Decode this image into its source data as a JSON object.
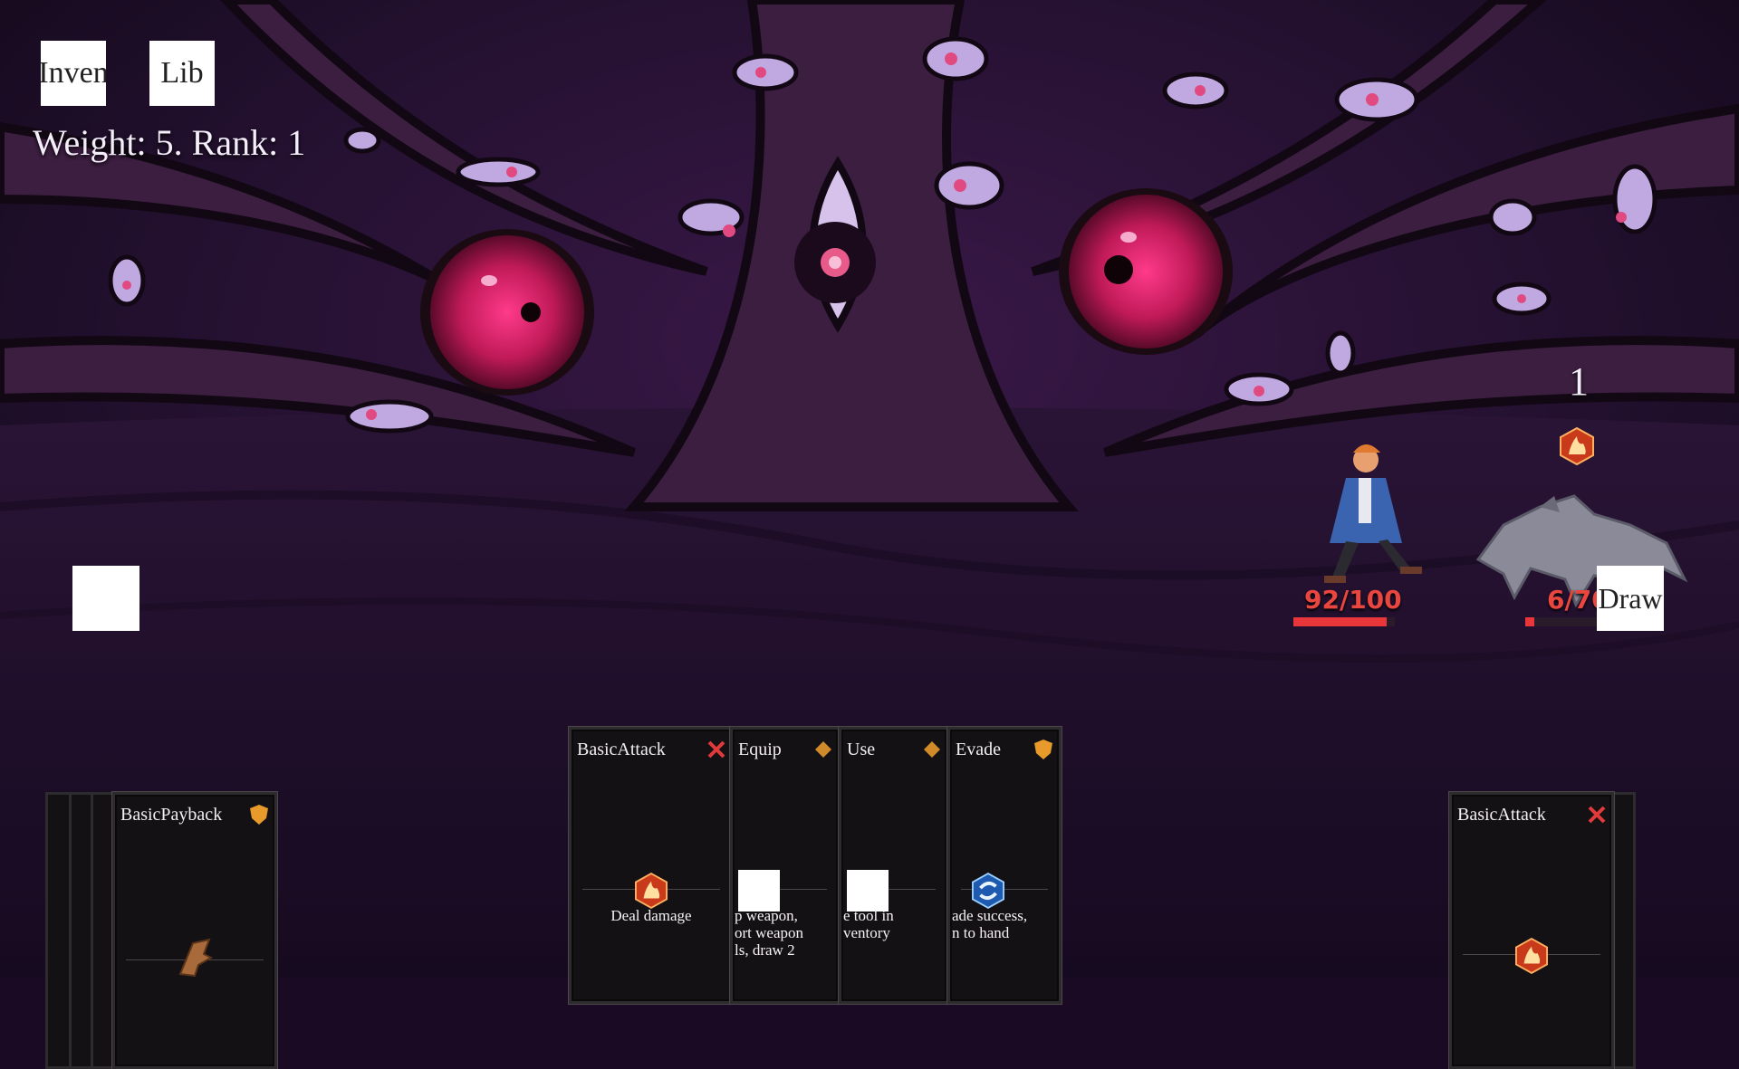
{
  "hud": {
    "inventory_label": "Inven",
    "library_label": "Lib",
    "stats_text": "Weight: 5. Rank: 1",
    "draw_label": "Draw"
  },
  "player": {
    "hp_text": "92/100",
    "hp_fraction": 0.92
  },
  "enemy": {
    "hp_text": "6/70",
    "hp_fraction": 0.086,
    "intent_count": "1",
    "intent_icon": "fire-icon"
  },
  "hand": [
    {
      "title": "BasicAttack",
      "type_icon": "x-icon",
      "gem": "fire-icon",
      "desc": [
        "Deal damage"
      ]
    },
    {
      "title": "Equip",
      "type_icon": "diamond-icon",
      "gem": "",
      "desc": [
        "p weapon,",
        "ort weapon",
        "ls, draw 2"
      ]
    },
    {
      "title": "Use",
      "type_icon": "diamond-icon",
      "gem": "",
      "desc": [
        "e tool in",
        "ventory"
      ]
    },
    {
      "title": "Evade",
      "type_icon": "shield-icon",
      "gem": "swirl-icon",
      "desc": [
        "ade success,",
        "n to hand"
      ]
    }
  ],
  "draw_pile_top": {
    "title": "BasicPayback",
    "type_icon": "shield-icon",
    "gem": "wing-icon"
  },
  "discard_pile_top": {
    "title": "BasicAttack",
    "type_icon": "x-icon",
    "gem": "fire-icon"
  },
  "colors": {
    "hp": "#e8363a",
    "x_icon": "#e03a3a",
    "diamond": "#d08a2a",
    "shield": "#e89a2a",
    "swirl": "#3a8ae0"
  }
}
